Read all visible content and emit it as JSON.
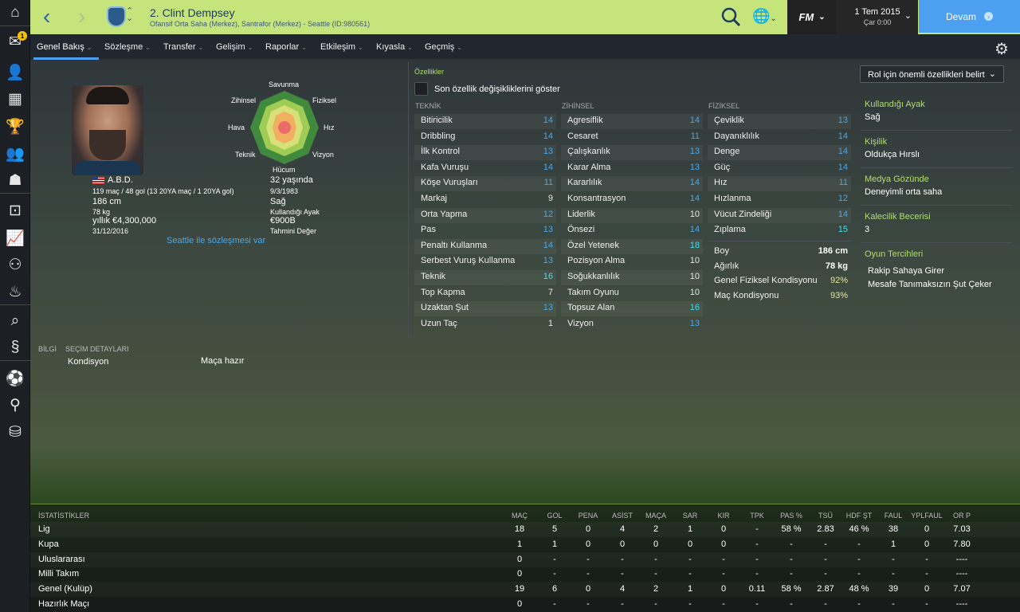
{
  "header": {
    "player_title": "2. Clint Dempsey",
    "player_sub": "Ofansif Orta Saha (Merkez), Santrafor (Merkez) - Seattle (ID:980561)",
    "date": "1 Tem 2015",
    "day": "Çar 0:00",
    "continue": "Devam",
    "fm": "FM"
  },
  "sidebar": {
    "badge": "1"
  },
  "tabs": [
    {
      "label": "Genel Bakış"
    },
    {
      "label": "Sözleşme"
    },
    {
      "label": "Transfer"
    },
    {
      "label": "Gelişim"
    },
    {
      "label": "Raporlar"
    },
    {
      "label": "Etkileşim"
    },
    {
      "label": "Kıyasla"
    },
    {
      "label": "Geçmiş"
    }
  ],
  "profile": {
    "nation": "A.B.D.",
    "caps": "119 maç / 48 gol (13 20YA maç / 1 20YA gol)",
    "height": "186 cm",
    "weight": "78 kg",
    "wage": "yıllık €4,300,000",
    "contract_end": "31/12/2016",
    "age": "32 yaşında",
    "dob": "9/3/1983",
    "foot": "Sağ",
    "foot_label": "Kullandığı Ayak",
    "value": "€900B",
    "value_label": "Tahmini Değer",
    "contract_link": "Seattle ile sözleşmesi var"
  },
  "radar": {
    "labels": [
      "Savunma",
      "Fiziksel",
      "Hız",
      "Vizyon",
      "Hücum",
      "Teknik",
      "Hava",
      "Zihinsel"
    ]
  },
  "attributes": {
    "title": "Özellikler",
    "show_changes": "Son özellik değişikliklerini göster",
    "dropdown": "Rol için önemli özellikleri belirt",
    "technical_head": "TEKNİK",
    "mental_head": "ZİHİNSEL",
    "physical_head": "FİZİKSEL",
    "technical": [
      {
        "n": "Bitiricilik",
        "v": "14"
      },
      {
        "n": "Dribbling",
        "v": "14"
      },
      {
        "n": "İlk Kontrol",
        "v": "13"
      },
      {
        "n": "Kafa Vuruşu",
        "v": "14"
      },
      {
        "n": "Köşe Vuruşları",
        "v": "11"
      },
      {
        "n": "Markaj",
        "v": "9"
      },
      {
        "n": "Orta Yapma",
        "v": "12"
      },
      {
        "n": "Pas",
        "v": "13"
      },
      {
        "n": "Penaltı Kullanma",
        "v": "14"
      },
      {
        "n": "Serbest Vuruş Kullanma",
        "v": "13"
      },
      {
        "n": "Teknik",
        "v": "16"
      },
      {
        "n": "Top Kapma",
        "v": "7"
      },
      {
        "n": "Uzaktan Şut",
        "v": "13"
      },
      {
        "n": "Uzun Taç",
        "v": "1"
      }
    ],
    "mental": [
      {
        "n": "Agresiflik",
        "v": "14"
      },
      {
        "n": "Cesaret",
        "v": "11"
      },
      {
        "n": "Çalışkanlık",
        "v": "13"
      },
      {
        "n": "Karar Alma",
        "v": "13"
      },
      {
        "n": "Kararlılık",
        "v": "14"
      },
      {
        "n": "Konsantrasyon",
        "v": "14"
      },
      {
        "n": "Liderlik",
        "v": "10"
      },
      {
        "n": "Önsezi",
        "v": "14"
      },
      {
        "n": "Özel Yetenek",
        "v": "18"
      },
      {
        "n": "Pozisyon Alma",
        "v": "10"
      },
      {
        "n": "Soğukkanlılık",
        "v": "10"
      },
      {
        "n": "Takım Oyunu",
        "v": "10"
      },
      {
        "n": "Topsuz Alan",
        "v": "16"
      },
      {
        "n": "Vizyon",
        "v": "13"
      }
    ],
    "physical": [
      {
        "n": "Çeviklik",
        "v": "13"
      },
      {
        "n": "Dayanıklılık",
        "v": "14"
      },
      {
        "n": "Denge",
        "v": "14"
      },
      {
        "n": "Güç",
        "v": "14"
      },
      {
        "n": "Hız",
        "v": "11"
      },
      {
        "n": "Hızlanma",
        "v": "12"
      },
      {
        "n": "Vücut Zindeliği",
        "v": "14"
      },
      {
        "n": "Zıplama",
        "v": "15"
      }
    ],
    "misc": [
      {
        "n": "Boy",
        "v": "186 cm"
      },
      {
        "n": "Ağırlık",
        "v": "78 kg"
      },
      {
        "n": "Genel Fiziksel Kondisyonu",
        "v": "92%"
      },
      {
        "n": "Maç Kondisyonu",
        "v": "93%"
      }
    ]
  },
  "right_panel": {
    "foot_h": "Kullandığı Ayak",
    "foot_v": "Sağ",
    "pers_h": "Kişilik",
    "pers_v": "Oldukça Hırslı",
    "media_h": "Medya Gözünde",
    "media_v": "Deneyimli orta saha",
    "gk_h": "Kalecilik Becerisi",
    "gk_v": "3",
    "prefs_h": "Oyun Tercihleri",
    "prefs": [
      "Rakip Sahaya Girer",
      "Mesafe Tanımaksızın Şut Çeker"
    ]
  },
  "info": {
    "tab1": "BİLGİ",
    "tab2": "SEÇİM DETAYLARI",
    "cond_label": "Kondisyon",
    "cond_value": "Maça hazır"
  },
  "stats": {
    "title": "İSTATİSTİKLER",
    "headers": [
      "MAÇ",
      "GOL",
      "PENA",
      "ASİST",
      "MAÇA",
      "SAR",
      "KIR",
      "TPK",
      "PAS %",
      "TSÜ",
      "HDF ŞT",
      "FAUL",
      "YPLFAUL",
      "OR P"
    ],
    "rows": [
      {
        "label": "Lig",
        "c": [
          "18",
          "5",
          "0",
          "4",
          "2",
          "1",
          "0",
          "-",
          "58 %",
          "2.83",
          "46 %",
          "38",
          "0",
          "7.03"
        ]
      },
      {
        "label": "Kupa",
        "c": [
          "1",
          "1",
          "0",
          "0",
          "0",
          "0",
          "0",
          "-",
          "-",
          "-",
          "-",
          "1",
          "0",
          "7.80"
        ]
      },
      {
        "label": "Uluslararası",
        "c": [
          "0",
          "-",
          "-",
          "-",
          "-",
          "-",
          "-",
          "-",
          "-",
          "-",
          "-",
          "-",
          "-",
          "----"
        ]
      },
      {
        "label": "Milli Takım",
        "c": [
          "0",
          "-",
          "-",
          "-",
          "-",
          "-",
          "-",
          "-",
          "-",
          "-",
          "-",
          "-",
          "-",
          "----"
        ]
      },
      {
        "label": "Genel (Kulüp)",
        "c": [
          "19",
          "6",
          "0",
          "4",
          "2",
          "1",
          "0",
          "0.11",
          "58 %",
          "2.87",
          "48 %",
          "39",
          "0",
          "7.07"
        ]
      },
      {
        "label": "Hazırlık Maçı",
        "c": [
          "0",
          "-",
          "-",
          "-",
          "-",
          "-",
          "-",
          "-",
          "-",
          "-",
          "-",
          "-",
          "-",
          "----"
        ]
      }
    ]
  },
  "colors": {
    "accent": "#c5e47c",
    "continue": "#4d9ff0",
    "value_blue": "#4aa8e8",
    "value_cyan": "#3fe0f0",
    "value_white": "#e8e8e8",
    "heading_green": "#b2dd73"
  }
}
